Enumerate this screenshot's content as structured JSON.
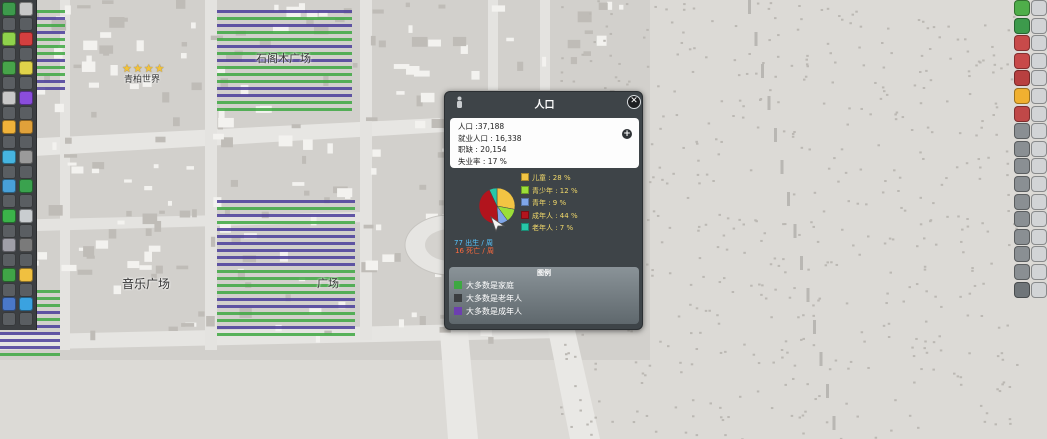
{
  "map": {
    "labels": {
      "top_square": "石阁木广场",
      "left_landmark": "青柏世界",
      "left_stars": "★★★★",
      "music_square": "音乐广场",
      "south_square": "广场"
    }
  },
  "left_toolbar": {
    "icons": [
      "circle-icon",
      "document-icon",
      "smiley-icon",
      "road-icon",
      "house-icon",
      "zone-icon",
      "car-icon",
      "lock-icon",
      "headphones-icon",
      "road-arc-icon",
      "water-drop-icon",
      "tree-icon",
      "fire-icon",
      "landscaping-icon",
      "area-icon",
      "wrench-icon",
      "district-icon",
      "chart-icon",
      "transport-icon",
      "pipe-icon",
      "bulldozer-icon",
      "arrow-icon"
    ],
    "colors": [
      "#3d9a4c",
      "#c8c8c8",
      "#8fd24c",
      "#d43f3f",
      "#47a44a",
      "#e0d34a",
      "#c8c8c8",
      "#8a4ddc",
      "#f0b23a",
      "#e0a13a",
      "#46b4e0",
      "#9a9a9a",
      "#48a0d8",
      "#3aa24e",
      "#3bb34a",
      "#c9cdd0",
      "#9f9fa8",
      "#7a7a7a",
      "#40a447",
      "#f0c040",
      "#4a78c8",
      "#3aa2e0"
    ]
  },
  "right_toolbar": {
    "icons": [
      "pencil-icon",
      "leaf-icon",
      "bus-icon",
      "home-icon",
      "factory-icon",
      "money-icon",
      "alert-icon",
      "gear-icon",
      "box-icon",
      "shop-icon",
      "camera-icon",
      "people-icon",
      "mountain-icon",
      "grid-icon",
      "person-icon",
      "smile-icon",
      "compass-icon"
    ],
    "colors": [
      "#4fae4a",
      "#3d9a4c",
      "#c84a4a",
      "#c84a4a",
      "#b84040",
      "#f0b030",
      "#c04848",
      "#8a8f93",
      "#8a8f93",
      "#8a8f93",
      "#8a8f93",
      "#8a8f93",
      "#8a8f93",
      "#8a8f93",
      "#8a8f93",
      "#8a8f93",
      "#6f7579"
    ]
  },
  "panel": {
    "title": "人口",
    "close_symbol": "✕",
    "stats": {
      "population": "人口 :37,188",
      "employed": "就业人口 : 16,338",
      "jobs": "职缺 : 20,154",
      "unemployment": "失业率 : 17 %"
    },
    "expand_symbol": "+",
    "age_groups": [
      {
        "label": "儿童 : 28 %",
        "percent": 28,
        "color": "#f2c443"
      },
      {
        "label": "青少年 : 12 %",
        "percent": 12,
        "color": "#9bde38"
      },
      {
        "label": "青年 : 9 %",
        "percent": 9,
        "color": "#7fa6e8"
      },
      {
        "label": "成年人 : 44 %",
        "percent": 44,
        "color": "#b2141d"
      },
      {
        "label": "老年人 : 7 %",
        "percent": 7,
        "color": "#27c7a8"
      }
    ],
    "births": "77 出生 / 周",
    "deaths": "16 死亡 / 周",
    "legend": {
      "title": "图例",
      "items": [
        {
          "label": "大多数是家庭",
          "color": "#3ea842"
        },
        {
          "label": "大多数是老年人",
          "color": "#3b3e40"
        },
        {
          "label": "大多数是成年人",
          "color": "#6d3fb0"
        }
      ]
    }
  }
}
